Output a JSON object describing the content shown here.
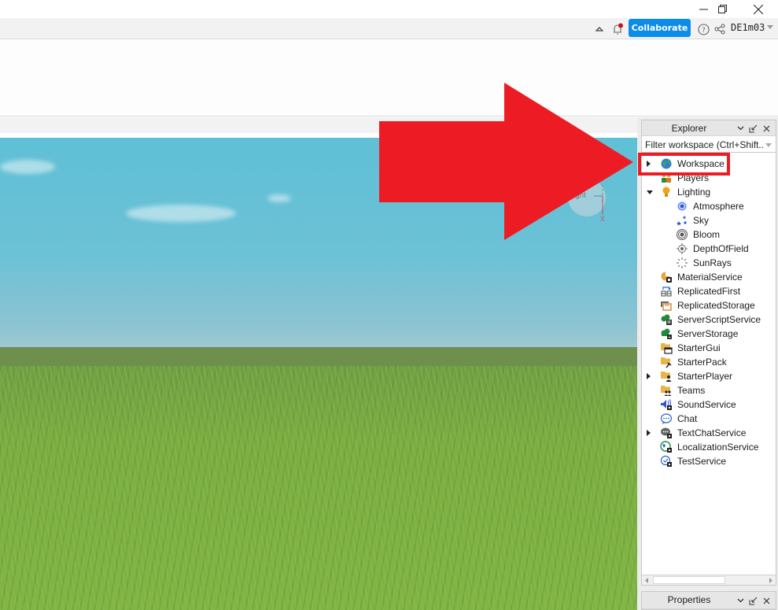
{
  "window": {
    "controls": {
      "minimize": "minimize-icon",
      "restore": "restore-icon",
      "close": "close-icon"
    }
  },
  "topbar": {
    "collaborate_label": "Collaborate",
    "username": "DE1m03",
    "icons": [
      "chevron-up-icon",
      "notification-bell-icon",
      "help-icon",
      "share-icon",
      "chevron-down-icon"
    ],
    "notification_dot_color": "#c0161c",
    "collaborate_color": "#0b8ce9"
  },
  "viewport": {
    "gizmo_label": "ght",
    "gizmo_axis": "X"
  },
  "annotation": {
    "arrow_color": "#ed1c24",
    "highlight_target": "Workspace"
  },
  "explorer": {
    "title": "Explorer",
    "filter_placeholder": "Filter workspace (Ctrl+Shift...",
    "items": [
      {
        "label": "Workspace",
        "icon": "workspace-icon",
        "expander": "closed",
        "depth": 0
      },
      {
        "label": "Players",
        "icon": "players-icon",
        "expander": "none",
        "depth": 0
      },
      {
        "label": "Lighting",
        "icon": "lighting-icon",
        "expander": "open",
        "depth": 0
      },
      {
        "label": "Atmosphere",
        "icon": "atmosphere-icon",
        "expander": "none",
        "depth": 1
      },
      {
        "label": "Sky",
        "icon": "sky-icon",
        "expander": "none",
        "depth": 1
      },
      {
        "label": "Bloom",
        "icon": "bloom-icon",
        "expander": "none",
        "depth": 1
      },
      {
        "label": "DepthOfField",
        "icon": "depth-of-field-icon",
        "expander": "none",
        "depth": 1
      },
      {
        "label": "SunRays",
        "icon": "sunrays-icon",
        "expander": "none",
        "depth": 1
      },
      {
        "label": "MaterialService",
        "icon": "material-service-icon",
        "expander": "none",
        "depth": 0
      },
      {
        "label": "ReplicatedFirst",
        "icon": "replicated-first-icon",
        "expander": "none",
        "depth": 0
      },
      {
        "label": "ReplicatedStorage",
        "icon": "replicated-storage-icon",
        "expander": "none",
        "depth": 0
      },
      {
        "label": "ServerScriptService",
        "icon": "server-script-service-icon",
        "expander": "none",
        "depth": 0
      },
      {
        "label": "ServerStorage",
        "icon": "server-storage-icon",
        "expander": "none",
        "depth": 0
      },
      {
        "label": "StarterGui",
        "icon": "starter-gui-icon",
        "expander": "none",
        "depth": 0
      },
      {
        "label": "StarterPack",
        "icon": "starter-pack-icon",
        "expander": "none",
        "depth": 0
      },
      {
        "label": "StarterPlayer",
        "icon": "starter-player-icon",
        "expander": "closed",
        "depth": 0
      },
      {
        "label": "Teams",
        "icon": "teams-icon",
        "expander": "none",
        "depth": 0
      },
      {
        "label": "SoundService",
        "icon": "sound-service-icon",
        "expander": "none",
        "depth": 0
      },
      {
        "label": "Chat",
        "icon": "chat-icon",
        "expander": "none",
        "depth": 0
      },
      {
        "label": "TextChatService",
        "icon": "text-chat-service-icon",
        "expander": "closed",
        "depth": 0
      },
      {
        "label": "LocalizationService",
        "icon": "localization-service-icon",
        "expander": "none",
        "depth": 0
      },
      {
        "label": "TestService",
        "icon": "test-service-icon",
        "expander": "none",
        "depth": 0
      }
    ]
  },
  "properties": {
    "title": "Properties"
  }
}
